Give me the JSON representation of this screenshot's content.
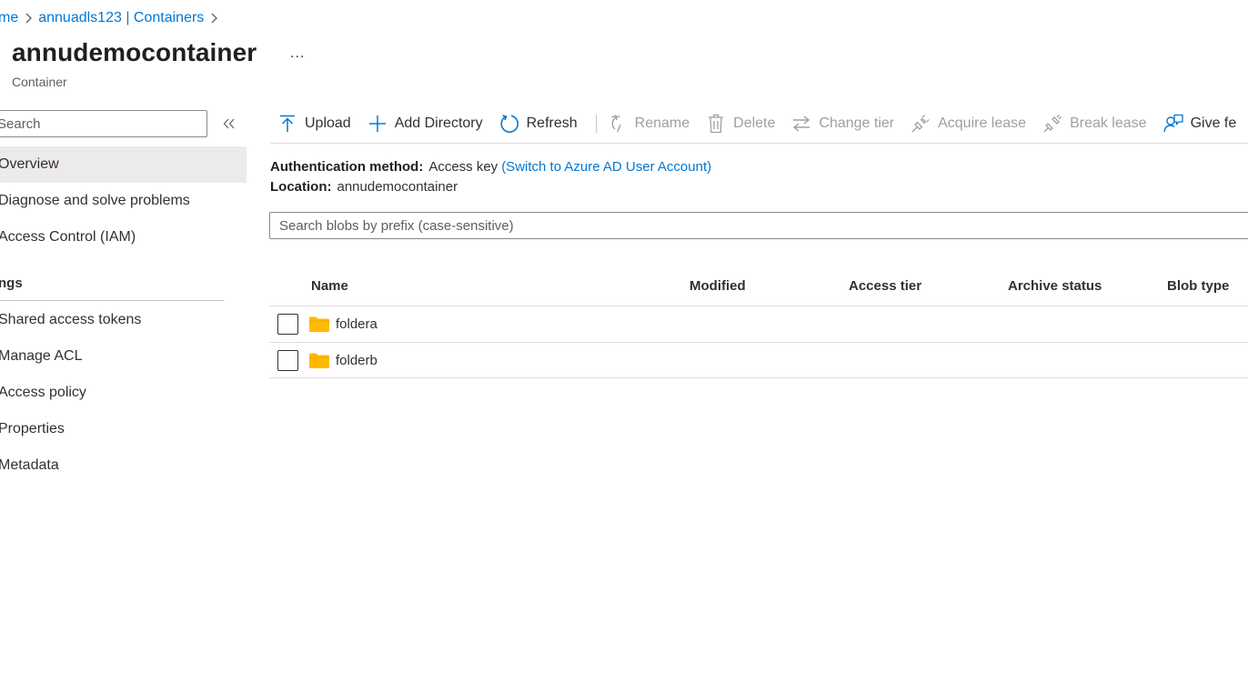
{
  "breadcrumb": {
    "home": "me",
    "account": "annuadls123 | Containers"
  },
  "header": {
    "title": "annudemocontainer",
    "more": "...",
    "subtitle": "Container"
  },
  "sidebar": {
    "search_placeholder": "Search",
    "items": [
      {
        "label": "Overview",
        "active": true
      },
      {
        "label": "Diagnose and solve problems"
      },
      {
        "label": "Access Control (IAM)"
      }
    ],
    "section": "ngs",
    "settings_items": [
      {
        "label": "Shared access tokens"
      },
      {
        "label": "Manage ACL"
      },
      {
        "label": "Access policy"
      },
      {
        "label": "Properties"
      },
      {
        "label": "Metadata"
      }
    ]
  },
  "toolbar": {
    "upload": "Upload",
    "add_directory": "Add Directory",
    "refresh": "Refresh",
    "rename": "Rename",
    "delete": "Delete",
    "change_tier": "Change tier",
    "acquire_lease": "Acquire lease",
    "break_lease": "Break lease",
    "give_feedback": "Give fe"
  },
  "info": {
    "auth_label": "Authentication method:",
    "auth_value": "Access key",
    "auth_link": "(Switch to Azure AD User Account)",
    "location_label": "Location:",
    "location_value": "annudemocontainer"
  },
  "blob_search": {
    "placeholder": "Search blobs by prefix (case-sensitive)"
  },
  "table": {
    "columns": [
      "Name",
      "Modified",
      "Access tier",
      "Archive status",
      "Blob type"
    ],
    "rows": [
      {
        "name": "foldera"
      },
      {
        "name": "folderb"
      }
    ]
  },
  "colors": {
    "accent": "#0078d4",
    "folder": "#ffb900",
    "selected_nav": "#edebe9"
  }
}
